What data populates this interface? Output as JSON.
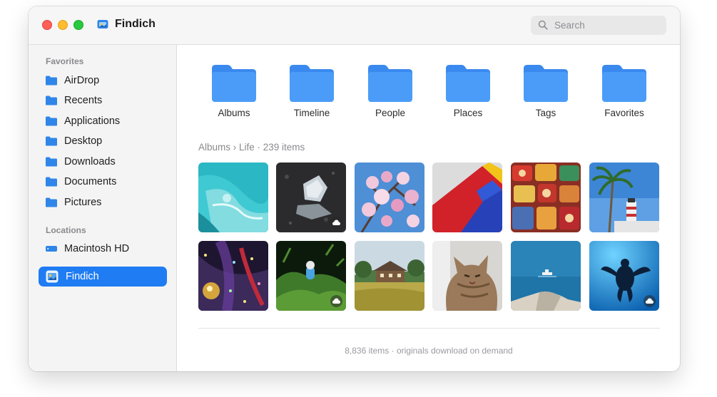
{
  "window": {
    "title": "Findich",
    "search_placeholder": "Search"
  },
  "sidebar": {
    "favorites_heading": "Favorites",
    "favorites": [
      {
        "label": "AirDrop",
        "icon": "folder-icon"
      },
      {
        "label": "Recents",
        "icon": "folder-icon"
      },
      {
        "label": "Applications",
        "icon": "folder-icon"
      },
      {
        "label": "Desktop",
        "icon": "folder-icon"
      },
      {
        "label": "Downloads",
        "icon": "folder-icon"
      },
      {
        "label": "Documents",
        "icon": "folder-icon"
      },
      {
        "label": "Pictures",
        "icon": "folder-icon"
      }
    ],
    "locations_heading": "Locations",
    "locations": [
      {
        "label": "Macintosh HD",
        "icon": "drive-icon"
      },
      {
        "label": "Findich",
        "icon": "findich-app-icon",
        "selected": true
      }
    ]
  },
  "main": {
    "folders": [
      {
        "label": "Albums"
      },
      {
        "label": "Timeline"
      },
      {
        "label": "People"
      },
      {
        "label": "Places"
      },
      {
        "label": "Tags"
      },
      {
        "label": "Favorites"
      }
    ],
    "breadcrumb": "Albums › Life · 239 items",
    "photos": [
      {
        "subject": "turquoise ice water",
        "cloud": false
      },
      {
        "subject": "ice on black sand",
        "cloud": true
      },
      {
        "subject": "magnolia blossoms",
        "cloud": false
      },
      {
        "subject": "red and blue paper",
        "cloud": false
      },
      {
        "subject": "colorful tins",
        "cloud": false
      },
      {
        "subject": "palm tree and lighthouse",
        "cloud": false
      },
      {
        "subject": "christmas tree lights",
        "cloud": false
      },
      {
        "subject": "figurine in moss",
        "cloud": true
      },
      {
        "subject": "farmhouse in field",
        "cloud": false
      },
      {
        "subject": "tabby cat",
        "cloud": false
      },
      {
        "subject": "boat on sea",
        "cloud": false
      },
      {
        "subject": "sea turtle silhouette",
        "cloud": true
      }
    ],
    "status": "8,836 items · originals download on demand"
  },
  "colors": {
    "accent": "#1f7cf3",
    "folder_blue": "#3d8ef5"
  }
}
